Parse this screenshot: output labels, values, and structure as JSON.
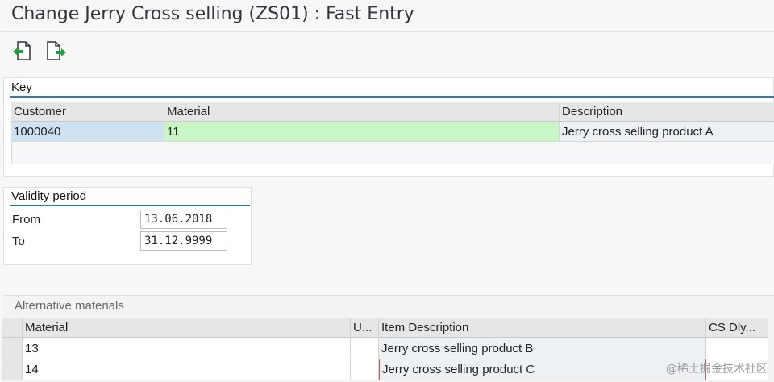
{
  "window": {
    "title": "Change Jerry Cross selling (ZS01) : Fast Entry"
  },
  "toolbar": {
    "buttons": [
      "prev-entry-icon",
      "next-entry-icon"
    ]
  },
  "key": {
    "title": "Key",
    "headers": {
      "customer": "Customer",
      "material": "Material",
      "description": "Description"
    },
    "row": {
      "customer": "1000040",
      "material": "11",
      "description": "Jerry cross selling product A"
    }
  },
  "validity": {
    "title": "Validity period",
    "from_label": "From",
    "from_value": "13.06.2018",
    "to_label": "To",
    "to_value": "31.12.9999"
  },
  "alternatives": {
    "title": "Alternative materials",
    "headers": {
      "material": "Material",
      "unit": "U...",
      "item_description": "Item Description",
      "cs_dly": "CS Dly..."
    },
    "rows": [
      {
        "material": "13",
        "unit": "",
        "item_description": "Jerry cross selling product B",
        "cs_dly": ""
      },
      {
        "material": "14",
        "unit": "",
        "item_description": "Jerry cross selling product C",
        "cs_dly": ""
      }
    ]
  },
  "watermark": "@稀土掘金技术社区",
  "colors": {
    "accent": "#2a7bb8",
    "material_cell": "#c8f7c5",
    "customer_cell": "#cfe2f1",
    "header": "#e6e6e6"
  }
}
